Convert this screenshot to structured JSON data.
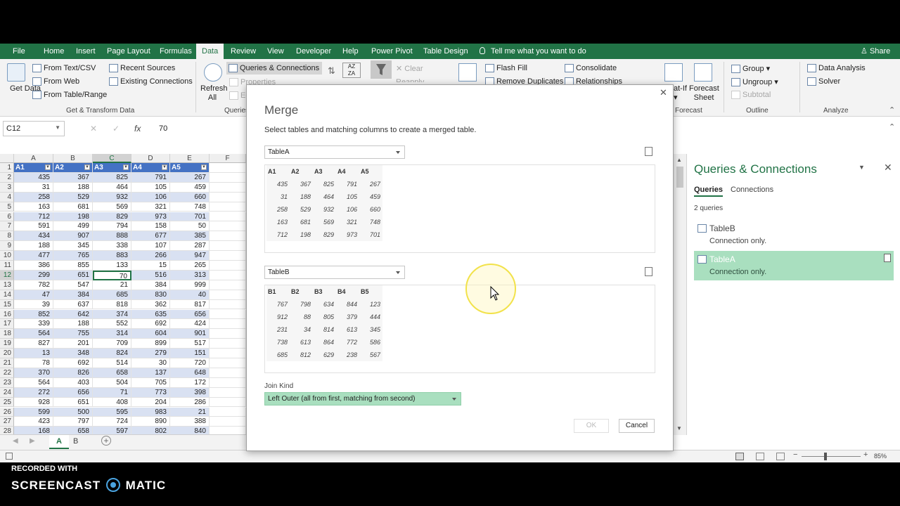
{
  "menu": {
    "tabs": [
      "File",
      "Home",
      "Insert",
      "Page Layout",
      "Formulas",
      "Data",
      "Review",
      "View",
      "Developer",
      "Help",
      "Power Pivot",
      "Table Design"
    ],
    "active": "Data",
    "tell_me": "Tell me what you want to do",
    "share": "Share"
  },
  "ribbon": {
    "get_data": "Get Data",
    "from_text_csv": "From Text/CSV",
    "from_web": "From Web",
    "from_table_range": "From Table/Range",
    "recent_sources": "Recent Sources",
    "existing_connections": "Existing Connections",
    "group_get_transform": "Get & Transform Data",
    "refresh_all": "Refresh All",
    "queries_connections": "Queries & Connections",
    "properties": "Properties",
    "edit_links": "Ed",
    "group_queries": "Queries",
    "clear": "Clear",
    "reapply": "Reapply",
    "flash_fill": "Flash Fill",
    "remove_duplicates": "Remove Duplicates",
    "consolidate": "Consolidate",
    "relationships": "Relationships",
    "what_if": "at-If",
    "forecast_sheet": "Forecast Sheet",
    "group_forecast": "Forecast",
    "group_btn": "Group",
    "ungroup": "Ungroup",
    "subtotal": "Subtotal",
    "group_outline": "Outline",
    "data_analysis": "Data Analysis",
    "solver": "Solver",
    "group_analyze": "Analyze"
  },
  "formula_bar": {
    "name_box": "C12",
    "fx": "fx",
    "value": "70"
  },
  "sheet": {
    "columns": [
      "A",
      "B",
      "C",
      "D",
      "E",
      "F"
    ],
    "header_row": [
      "A1",
      "A2",
      "A3",
      "A4",
      "A5"
    ],
    "rows": [
      [
        435,
        367,
        825,
        791,
        267
      ],
      [
        31,
        188,
        464,
        105,
        459
      ],
      [
        258,
        529,
        932,
        106,
        660
      ],
      [
        163,
        681,
        569,
        321,
        748
      ],
      [
        712,
        198,
        829,
        973,
        701
      ],
      [
        591,
        499,
        794,
        158,
        50
      ],
      [
        434,
        907,
        888,
        677,
        385
      ],
      [
        188,
        345,
        338,
        107,
        287
      ],
      [
        477,
        765,
        883,
        266,
        947
      ],
      [
        386,
        855,
        133,
        15,
        265
      ],
      [
        299,
        651,
        70,
        516,
        313
      ],
      [
        782,
        547,
        21,
        384,
        999
      ],
      [
        47,
        384,
        685,
        830,
        40
      ],
      [
        39,
        637,
        818,
        362,
        817
      ],
      [
        852,
        642,
        374,
        635,
        656
      ],
      [
        339,
        188,
        552,
        692,
        424
      ],
      [
        564,
        755,
        314,
        604,
        901
      ],
      [
        827,
        201,
        709,
        899,
        517
      ],
      [
        13,
        348,
        824,
        279,
        151
      ],
      [
        78,
        692,
        514,
        30,
        720
      ],
      [
        370,
        826,
        658,
        137,
        648
      ],
      [
        564,
        403,
        504,
        705,
        172
      ],
      [
        272,
        656,
        71,
        773,
        398
      ],
      [
        928,
        651,
        408,
        204,
        286
      ],
      [
        599,
        500,
        595,
        983,
        21
      ],
      [
        423,
        797,
        724,
        890,
        388
      ],
      [
        168,
        658,
        597,
        802,
        840
      ]
    ],
    "row_numbers": [
      1,
      2,
      3,
      4,
      5,
      6,
      7,
      8,
      9,
      10,
      11,
      12,
      13,
      14,
      15,
      16,
      17,
      18,
      19,
      20,
      21,
      22,
      23,
      24,
      25,
      26,
      27,
      28
    ],
    "tabs": [
      "A",
      "B"
    ]
  },
  "pane": {
    "title": "Queries & Connections",
    "tab_queries": "Queries",
    "tab_connections": "Connections",
    "count": "2 queries",
    "items": [
      {
        "name": "TableB",
        "desc": "Connection only."
      },
      {
        "name": "TableA",
        "desc": "Connection only."
      }
    ]
  },
  "merge": {
    "title": "Merge",
    "subtitle": "Select tables and matching columns to create a merged table.",
    "table1": "TableA",
    "table1_headers": [
      "A1",
      "A2",
      "A3",
      "A4",
      "A5"
    ],
    "table1_rows": [
      [
        435,
        367,
        825,
        791,
        267
      ],
      [
        31,
        188,
        464,
        105,
        459
      ],
      [
        258,
        529,
        932,
        106,
        660
      ],
      [
        163,
        681,
        569,
        321,
        748
      ],
      [
        712,
        198,
        829,
        973,
        701
      ]
    ],
    "table2": "TableB",
    "table2_headers": [
      "B1",
      "B2",
      "B3",
      "B4",
      "B5"
    ],
    "table2_rows": [
      [
        767,
        798,
        634,
        844,
        123
      ],
      [
        912,
        88,
        805,
        379,
        444
      ],
      [
        231,
        34,
        814,
        613,
        345
      ],
      [
        738,
        613,
        864,
        772,
        586
      ],
      [
        685,
        812,
        629,
        238,
        567
      ]
    ],
    "join_kind_label": "Join Kind",
    "join_kind": "Left Outer (all from first, matching from second)",
    "ok": "OK",
    "cancel": "Cancel"
  },
  "status": {
    "zoom": "85%"
  },
  "watermark": {
    "line1": "RECORDED WITH",
    "line2a": "SCREENCAST",
    "line2b": "MATIC"
  },
  "colors": {
    "excel_green": "#217346",
    "table_header": "#4472c4",
    "band": "#d9e1f2",
    "query_selected": "#a9dfbf",
    "cursor_highlight": "#ffeb3b"
  }
}
